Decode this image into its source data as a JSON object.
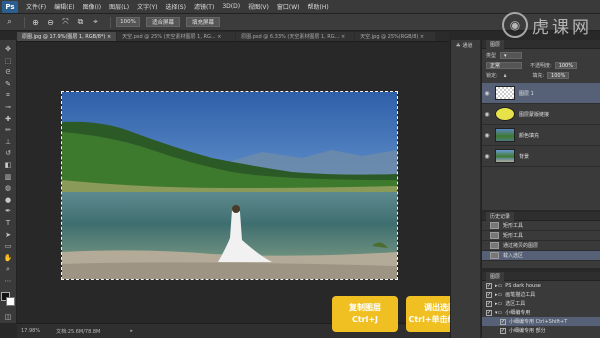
{
  "app": {
    "logo": "Ps"
  },
  "menu": [
    "文件(F)",
    "编辑(E)",
    "图像(I)",
    "图层(L)",
    "文字(Y)",
    "选择(S)",
    "滤镜(T)",
    "3D(D)",
    "视图(V)",
    "窗口(W)",
    "帮助(H)"
  ],
  "options": {
    "zoom": "100%",
    "fit_screen": "适合屏幕",
    "fill_screen": "填充屏幕"
  },
  "watermark": {
    "text": "虎课网"
  },
  "tabs": [
    {
      "label": "原图.jpg @ 17.9%(图层 1, RGB/8*) ×",
      "active": true
    },
    {
      "label": "天空.psd @ 25% (天空素材图层 1, RG... ×",
      "active": false
    },
    {
      "label": "原图.psd @ 6.33% (天空素材图层 1, RG... ×",
      "active": false
    },
    {
      "label": "天空.jpg @ 25%(RGB/8) ×",
      "active": false
    }
  ],
  "status": {
    "zoom": "17.98%",
    "doc": "文档:25.6M/78.8M"
  },
  "callouts": [
    {
      "line1": "复制图层",
      "line2": "Ctrl+J"
    },
    {
      "line1": "调出选区",
      "line2": "Ctrl+单击缩览图"
    }
  ],
  "midcol": {
    "label": "通道"
  },
  "layers_panel": {
    "tab": "图层",
    "kind_label": "类型",
    "blend": "正常",
    "opacity_label": "不透明度:",
    "opacity": "100%",
    "lock_label": "锁定:",
    "fill_label": "填充:",
    "fill": "100%",
    "layers": [
      {
        "name": "图层 1",
        "selected": true
      },
      {
        "name": "图层蒙版链接",
        "selected": false
      },
      {
        "name": "颜色填充",
        "selected": false
      },
      {
        "name": "背景",
        "selected": false
      }
    ]
  },
  "history_panel": {
    "tab": "历史记录",
    "items": [
      {
        "name": "矩形工具",
        "selected": false
      },
      {
        "name": "矩形工具",
        "selected": false
      },
      {
        "name": "通过拷贝的图层",
        "selected": false
      },
      {
        "name": "载入选区",
        "selected": true
      }
    ]
  },
  "layers2_panel": {
    "tab": "图层",
    "items": [
      {
        "name": "PS dark house",
        "selected": false
      },
      {
        "name": "画笔描边工具",
        "selected": false
      },
      {
        "name": "选区工具",
        "selected": false
      },
      {
        "name": "小细编专用",
        "selected": false
      },
      {
        "name": "小细编专用  Ctrl+Shift+T",
        "selected": true
      },
      {
        "name": "小细编专用 部分",
        "selected": false
      }
    ]
  },
  "colors": {
    "accent": "#f0c023",
    "selection": "#566177",
    "panel": "#3a3a3a",
    "canvas": "#282828"
  }
}
